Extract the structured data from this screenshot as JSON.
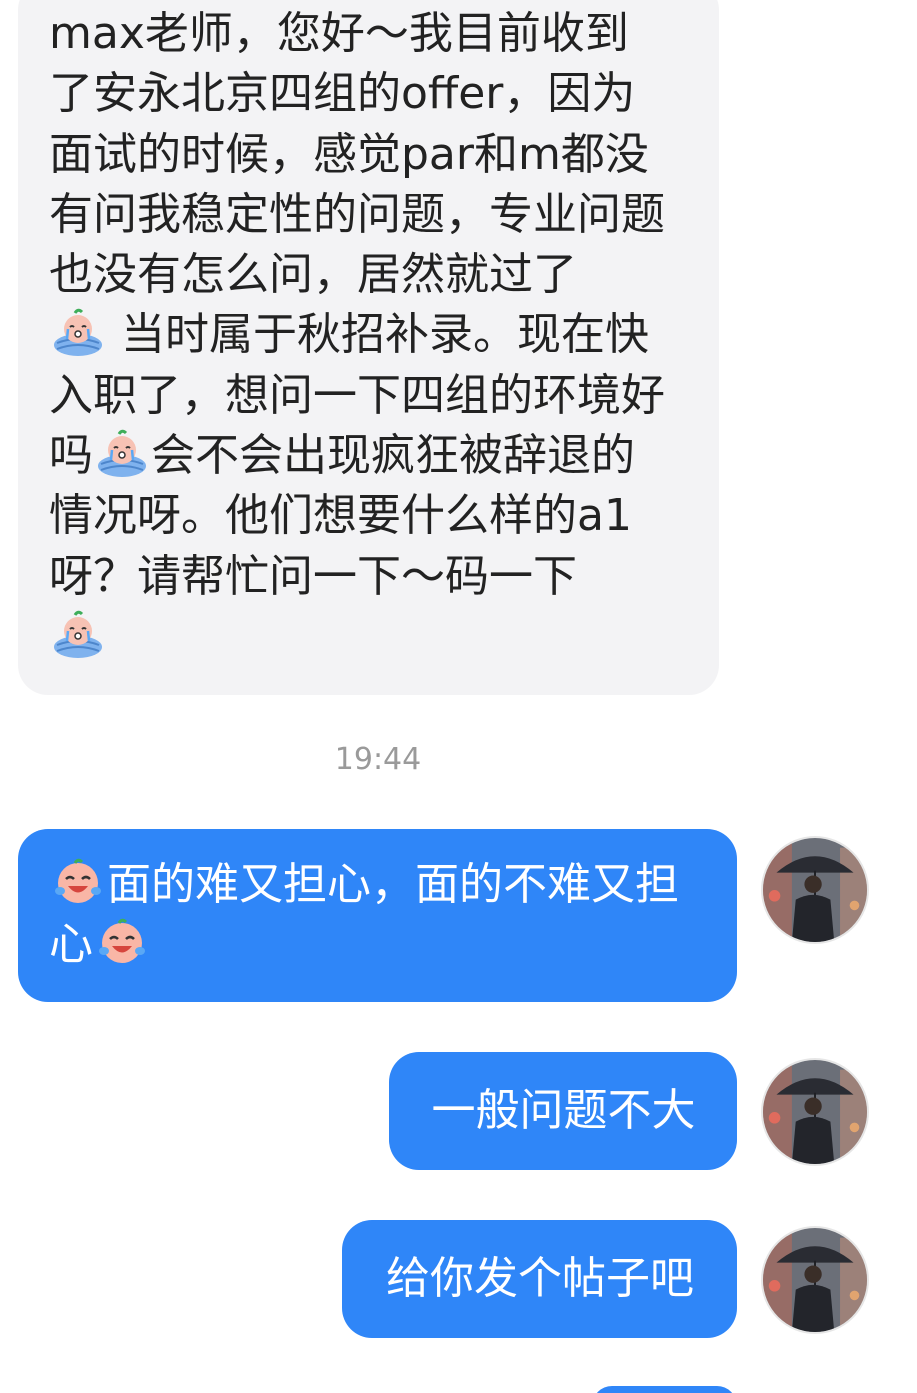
{
  "incoming_message": {
    "parts": [
      "max老师，您好～我目前收到了安永北京四组的offer，因为面试的时候，感觉par和m都没有问我稳定性的问题，专业问题也没有怎么问，居然就过了",
      " 当时属于秋招补录。现在快入职了，想问一下四组的环境好吗",
      "会不会出现疯狂被辞退的情况呀。他们想要什么样的a1呀？请帮忙问一下～码一下"
    ],
    "emoji": "crying-in-bed-emoji"
  },
  "timestamp": "19:44",
  "outgoing_messages": [
    {
      "parts": [
        "面的难又担心，面的不难又担心"
      ],
      "emoji": "laughing-crying-emoji"
    },
    {
      "text": "一般问题不大"
    },
    {
      "text": "给你发个帖子吧"
    }
  ],
  "avatar": {
    "icon": "man-with-umbrella-avatar"
  },
  "colors": {
    "outgoing_bubble": "#2f86f8",
    "incoming_bubble": "#f3f3f5",
    "timestamp": "#9a9a9a"
  }
}
